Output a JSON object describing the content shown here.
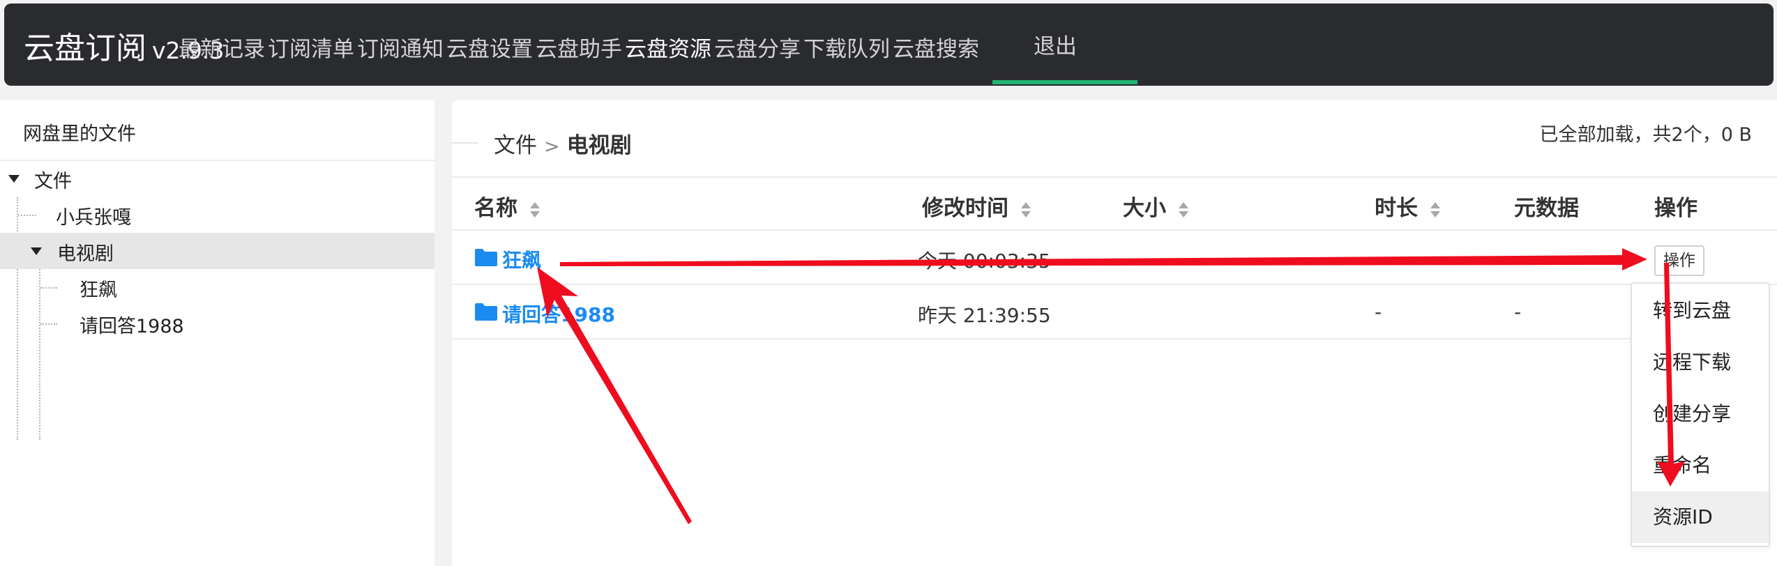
{
  "app": {
    "name": "云盘订阅",
    "version": "v2.9.3"
  },
  "nav": {
    "items": [
      "最新记录",
      "订阅清单",
      "订阅通知",
      "云盘设置",
      "云盘助手",
      "云盘资源",
      "云盘分享",
      "下载队列",
      "云盘搜索"
    ],
    "active": "云盘资源",
    "logout": "退出"
  },
  "sidebar": {
    "title": "网盘里的文件",
    "tree": {
      "root": "文件",
      "children": [
        "小兵张嘎",
        "电视剧"
      ],
      "selected": "电视剧",
      "grandchildren": [
        "狂飙",
        "请回答1988"
      ]
    }
  },
  "main": {
    "breadcrumb": [
      "文件",
      "电视剧"
    ],
    "breadcrumb_sep": ">",
    "load_status": "已全部加载，共2个，0 B",
    "columns": [
      "名称",
      "修改时间",
      "大小",
      "时长",
      "元数据",
      "操作"
    ],
    "rows": [
      {
        "name": "狂飙",
        "modified": "今天 00:03:35",
        "size": "",
        "duration": "",
        "meta": ""
      },
      {
        "name": "请回答1988",
        "modified": "昨天 21:39:55",
        "size": "",
        "duration": "-",
        "meta": "-"
      }
    ],
    "op_button": "操作",
    "menu": [
      "转到云盘",
      "远程下载",
      "创建分享",
      "重命名",
      "资源ID"
    ],
    "menu_hovered": "资源ID"
  },
  "colors": {
    "nav_bg": "#2a2b2f",
    "nav_active_underline": "#22b573",
    "link_blue": "#1a8bf0",
    "annotation_red": "#ee0d1e"
  },
  "icons": [
    "folder-icon",
    "sort-icon",
    "caret-down-icon"
  ]
}
